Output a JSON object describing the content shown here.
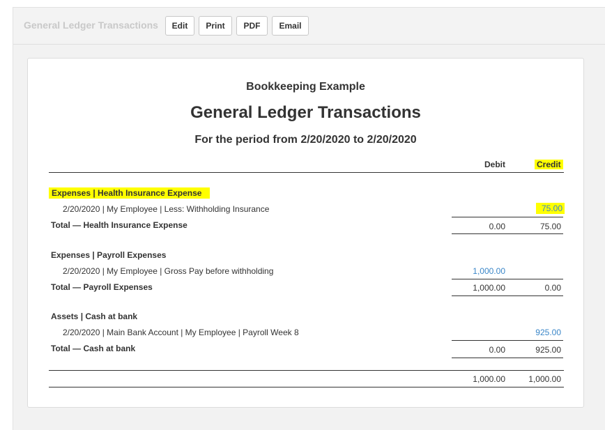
{
  "toolbar": {
    "title": "General Ledger Transactions",
    "buttons": [
      "Edit",
      "Print",
      "PDF",
      "Email"
    ]
  },
  "report": {
    "company": "Bookkeeping Example",
    "title": "General Ledger Transactions",
    "period": "For the period from 2/20/2020 to 2/20/2020",
    "columns": {
      "debit": "Debit",
      "credit": "Credit"
    },
    "sections": [
      {
        "account": "Expenses | Health Insurance Expense",
        "transaction": "2/20/2020 | My Employee | Less: Withholding Insurance",
        "tx_debit": "",
        "tx_credit": "75.00",
        "total_label": "Total — Health Insurance Expense",
        "total_debit": "0.00",
        "total_credit": "75.00"
      },
      {
        "account": "Expenses | Payroll Expenses",
        "transaction": "2/20/2020 | My Employee | Gross Pay before withholding",
        "tx_debit": "1,000.00",
        "tx_credit": "",
        "total_label": "Total — Payroll Expenses",
        "total_debit": "1,000.00",
        "total_credit": "0.00"
      },
      {
        "account": "Assets | Cash at bank",
        "transaction": "2/20/2020 | Main Bank Account | My Employee | Payroll Week 8",
        "tx_debit": "",
        "tx_credit": "925.00",
        "total_label": "Total — Cash at bank",
        "total_debit": "0.00",
        "total_credit": "925.00"
      }
    ],
    "grand_total": {
      "debit": "1,000.00",
      "credit": "1,000.00"
    }
  },
  "colors": {
    "highlight": "#ffff00",
    "link": "#3a86c8",
    "toolbar_title": "#c9c9c9"
  }
}
